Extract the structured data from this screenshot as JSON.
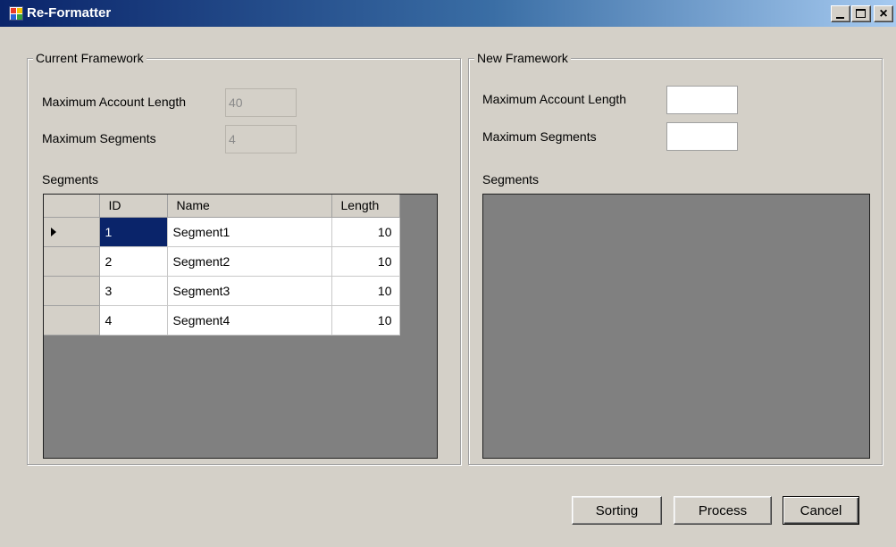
{
  "window": {
    "title": "Re-Formatter",
    "icon": "app-icon",
    "controls": {
      "minimize": "_",
      "maximize": "□",
      "close": "×"
    }
  },
  "current": {
    "group_label": "Current Framework",
    "max_account_length_label": "Maximum Account Length",
    "max_account_length_value": "40",
    "max_segments_label": "Maximum Segments",
    "max_segments_value": "4",
    "segments_label": "Segments",
    "grid": {
      "columns": [
        "ID",
        "Name",
        "Length"
      ],
      "rows": [
        {
          "id": "1",
          "name": "Segment1",
          "length": "10"
        },
        {
          "id": "2",
          "name": "Segment2",
          "length": "10"
        },
        {
          "id": "3",
          "name": "Segment3",
          "length": "10"
        },
        {
          "id": "4",
          "name": "Segment4",
          "length": "10"
        }
      ],
      "selected_row": 0
    }
  },
  "new": {
    "group_label": "New Framework",
    "max_account_length_label": "Maximum Account Length",
    "max_account_length_value": "",
    "max_segments_label": "Maximum Segments",
    "max_segments_value": "",
    "segments_label": "Segments"
  },
  "buttons": {
    "sorting": "Sorting",
    "process": "Process",
    "cancel": "Cancel"
  },
  "colors": {
    "titlebar_start": "#0a246a",
    "titlebar_end": "#a6caf0",
    "window_bg": "#d4d0c8",
    "grid_bg": "#808080",
    "selection": "#0a246a"
  }
}
